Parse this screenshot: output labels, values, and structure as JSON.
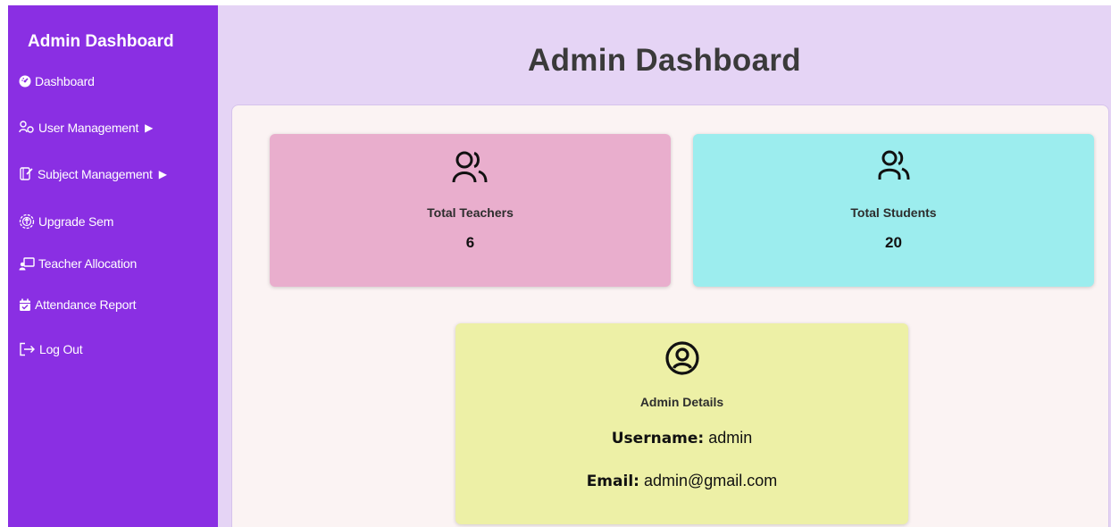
{
  "sidebar": {
    "brand": "Admin Dashboard",
    "items": [
      {
        "label": "Dashboard",
        "icon": "dashboard-gauge-icon"
      },
      {
        "label": "User Management",
        "arrow": "▶",
        "icon": "user-management-icon"
      },
      {
        "label": "Subject Management",
        "arrow": "▶",
        "icon": "subject-book-icon"
      },
      {
        "label": "Upgrade Sem",
        "icon": "upgrade-circle-icon"
      },
      {
        "label": "Teacher Allocation",
        "icon": "teacher-board-icon"
      },
      {
        "label": "Attendance Report",
        "icon": "calendar-check-icon"
      },
      {
        "label": "Log Out",
        "icon": "logout-icon"
      }
    ],
    "color": "#8a2fe3"
  },
  "header": {
    "title": "Admin Dashboard",
    "background": "#e5d4f5"
  },
  "cards": {
    "teachers": {
      "label": "Total Teachers",
      "value": "6",
      "color": "#e9aecd",
      "icon": "users-icon"
    },
    "students": {
      "label": "Total Students",
      "value": "20",
      "color": "#9cedee",
      "icon": "students-icon"
    }
  },
  "admin": {
    "title": "Admin Details",
    "username_label": "Username:",
    "username": "admin",
    "email_label": "Email:",
    "email": "admin@gmail.com",
    "color": "#edf0a6",
    "icon": "user-circle-icon"
  }
}
